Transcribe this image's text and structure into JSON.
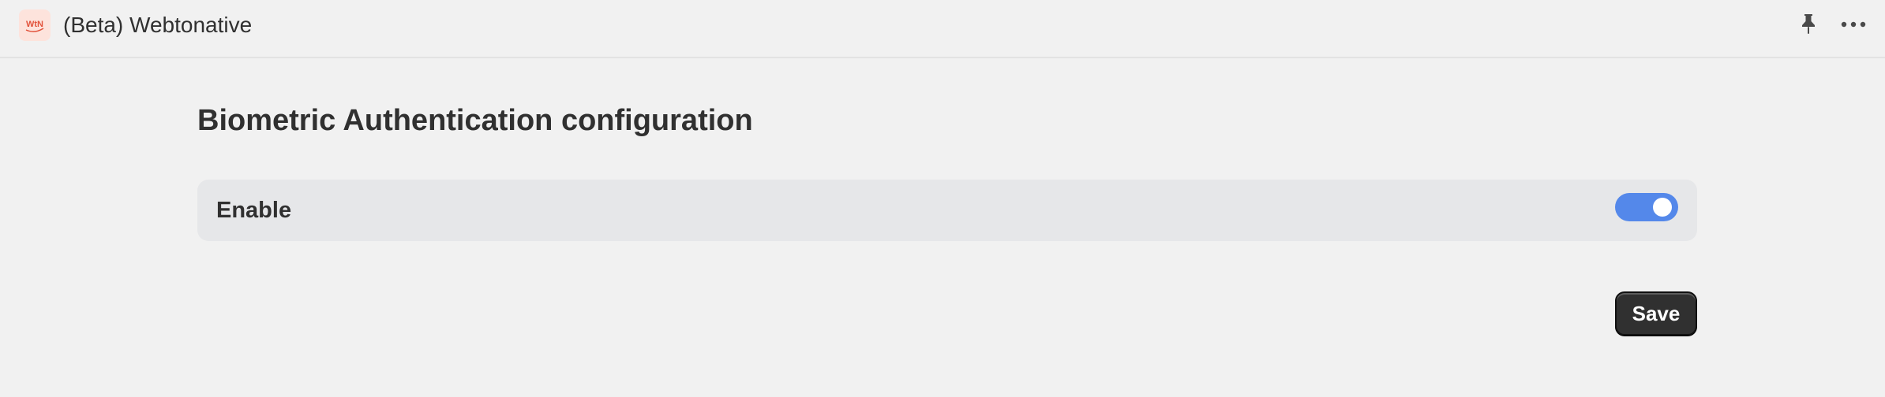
{
  "header": {
    "app_title": "(Beta) Webtonative",
    "logo_icon": "webtonative-logo-icon",
    "logo_text": "WtN",
    "pin_icon": "pin-icon",
    "more_icon": "more-horizontal-icon"
  },
  "main": {
    "page_title": "Biometric Authentication configuration",
    "setting": {
      "label": "Enable",
      "enabled": true
    },
    "save_label": "Save"
  },
  "colors": {
    "toggle_on": "#5488ea",
    "save_button": "#303030",
    "logo_bg": "#fde3dc",
    "logo_fg": "#e2533c"
  }
}
